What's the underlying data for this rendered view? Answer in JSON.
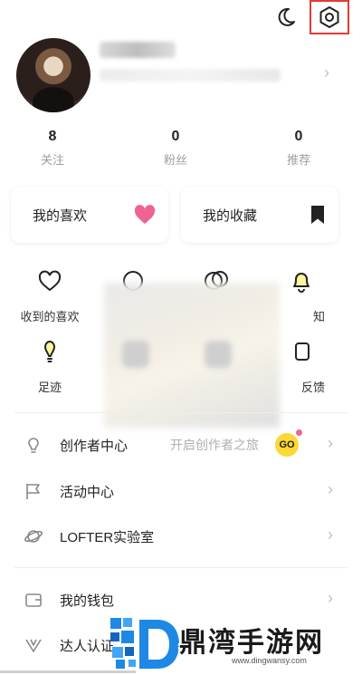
{
  "header": {
    "moon_icon": "moon-icon",
    "settings_icon": "gear-icon",
    "highlight_color": "#e53935"
  },
  "profile": {
    "avatar_icon": "avatar"
  },
  "stats": [
    {
      "value": "8",
      "label": "关注"
    },
    {
      "value": "0",
      "label": "粉丝"
    },
    {
      "value": "0",
      "label": "推荐"
    }
  ],
  "cards": {
    "likes": {
      "label": "我的喜欢",
      "icon": "heart-icon",
      "color": "#f06292"
    },
    "favorites": {
      "label": "我的收藏",
      "icon": "bookmark-icon",
      "color": "#222222"
    }
  },
  "grid": [
    {
      "label": "收到的喜欢",
      "icon": "heart-outline-icon"
    },
    {
      "label": "知",
      "icon": "bell-icon"
    },
    {
      "label": "足迹",
      "icon": "footprint-icon"
    },
    {
      "label": "反馈",
      "icon": "feedback-icon"
    }
  ],
  "menu": [
    {
      "label": "创作者中心",
      "hint": "开启创作者之旅",
      "badge": "GO",
      "icon": "lightbulb-icon"
    },
    {
      "label": "活动中心",
      "icon": "flag-icon"
    },
    {
      "label": "LOFTER实验室",
      "icon": "planet-icon"
    },
    {
      "label": "我的钱包",
      "icon": "wallet-icon"
    },
    {
      "label": "达人认证",
      "icon": "verified-v-icon"
    }
  ],
  "watermark": {
    "text": "鼎湾手游网",
    "url": "www.dingwansy.com"
  },
  "colors": {
    "accent_pink": "#f06292",
    "go_yellow": "#fdd835"
  }
}
